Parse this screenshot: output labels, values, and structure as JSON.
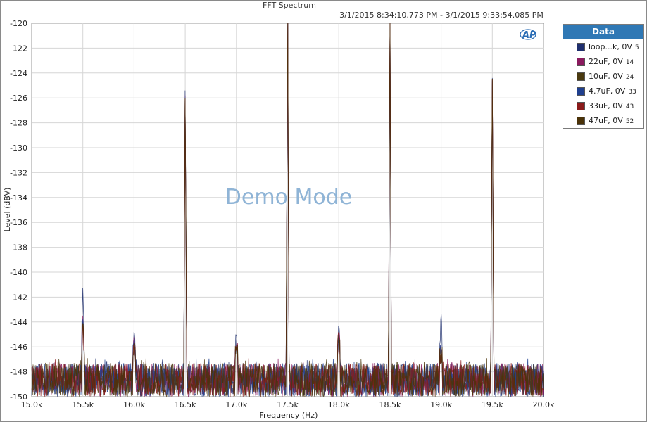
{
  "chart_data": {
    "type": "line",
    "title": "FFT Spectrum",
    "subtitle": "3/1/2015 8:34:10.773 PM - 3/1/2015 9:33:54.085 PM",
    "watermark": "Demo Mode",
    "logo_text": "AP",
    "xlabel": "Frequency (Hz)",
    "ylabel": "Level (dBV)",
    "xlim": [
      15000,
      20000
    ],
    "ylim": [
      -150,
      -120
    ],
    "grid": true,
    "x_ticks": [
      15000,
      15500,
      16000,
      16500,
      17000,
      17500,
      18000,
      18500,
      19000,
      19500,
      20000
    ],
    "x_tick_labels": [
      "15.0k",
      "15.5k",
      "16.0k",
      "16.5k",
      "17.0k",
      "17.5k",
      "18.0k",
      "18.5k",
      "19.0k",
      "19.5k",
      "20.0k"
    ],
    "y_ticks": [
      -150,
      -148,
      -146,
      -144,
      -142,
      -140,
      -138,
      -136,
      -134,
      -132,
      -130,
      -128,
      -126,
      -124,
      -122,
      -120
    ],
    "legend": {
      "title": "Data",
      "placement": "right"
    },
    "noise_floor": [
      -150,
      -147.3
    ],
    "series": [
      {
        "name": "loop...k, 0V",
        "index": "5",
        "color": "#1f2f6e",
        "peaks": [
          [
            15500,
            -141.3
          ],
          [
            16000,
            -144.8
          ],
          [
            16500,
            -125.4
          ],
          [
            17000,
            -145.1
          ],
          [
            17500,
            -120
          ],
          [
            18000,
            -144.3
          ],
          [
            18500,
            -120
          ],
          [
            19000,
            -143.4
          ],
          [
            19500,
            -124.4
          ]
        ]
      },
      {
        "name": "22uF, 0V",
        "index": "14",
        "color": "#8a1a5e",
        "peaks": [
          [
            15500,
            -143.5
          ],
          [
            16000,
            -145.2
          ],
          [
            16500,
            -125.8
          ],
          [
            17000,
            -146.0
          ],
          [
            17500,
            -120
          ],
          [
            18000,
            -144.8
          ],
          [
            18500,
            -120
          ],
          [
            19000,
            -146.5
          ],
          [
            19500,
            -124.6
          ]
        ]
      },
      {
        "name": "10uF, 0V",
        "index": "24",
        "color": "#4a3a10",
        "peaks": [
          [
            15500,
            -144.0
          ],
          [
            16000,
            -146.0
          ],
          [
            16500,
            -126.0
          ],
          [
            17000,
            -146.2
          ],
          [
            17500,
            -120
          ],
          [
            18000,
            -145.0
          ],
          [
            18500,
            -120
          ],
          [
            19000,
            -147.0
          ],
          [
            19500,
            -124.5
          ]
        ]
      },
      {
        "name": "4.7uF, 0V",
        "index": "33",
        "color": "#1f3f8e",
        "peaks": [
          [
            15500,
            -143.8
          ],
          [
            16000,
            -145.5
          ],
          [
            16500,
            -125.9
          ],
          [
            17000,
            -146.1
          ],
          [
            17500,
            -120
          ],
          [
            18000,
            -144.9
          ],
          [
            18500,
            -120
          ],
          [
            19000,
            -146.8
          ],
          [
            19500,
            -124.6
          ]
        ]
      },
      {
        "name": "33uF, 0V",
        "index": "43",
        "color": "#8a1a1a",
        "peaks": [
          [
            15500,
            -144.2
          ],
          [
            16000,
            -146.2
          ],
          [
            16500,
            -126.0
          ],
          [
            17000,
            -146.3
          ],
          [
            17500,
            -120
          ],
          [
            18000,
            -145.1
          ],
          [
            18500,
            -120
          ],
          [
            19000,
            -147.2
          ],
          [
            19500,
            -124.5
          ]
        ]
      },
      {
        "name": "47uF, 0V",
        "index": "52",
        "color": "#4a3208",
        "peaks": [
          [
            15500,
            -144.1
          ],
          [
            16000,
            -146.1
          ],
          [
            16500,
            -126.0
          ],
          [
            17000,
            -146.2
          ],
          [
            17500,
            -120
          ],
          [
            18000,
            -145.0
          ],
          [
            18500,
            -120
          ],
          [
            19000,
            -147.1
          ],
          [
            19500,
            -124.5
          ]
        ]
      }
    ]
  }
}
